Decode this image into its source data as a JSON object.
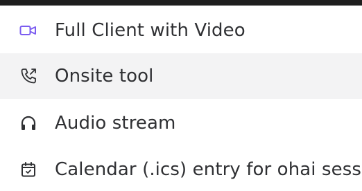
{
  "menu": {
    "items": [
      {
        "label": "Full Client with Video",
        "icon": "video-camera-icon",
        "icon_color": "#7b5cf0"
      },
      {
        "label": "Onsite tool",
        "icon": "phone-outgoing-icon",
        "icon_color": "#2f3033"
      },
      {
        "label": "Audio stream",
        "icon": "headphones-icon",
        "icon_color": "#2f3033"
      },
      {
        "label": "Calendar (.ics) entry for ohai sess",
        "icon": "calendar-check-icon",
        "icon_color": "#2f3033"
      }
    ],
    "hover_background": "#f3f3f4"
  }
}
